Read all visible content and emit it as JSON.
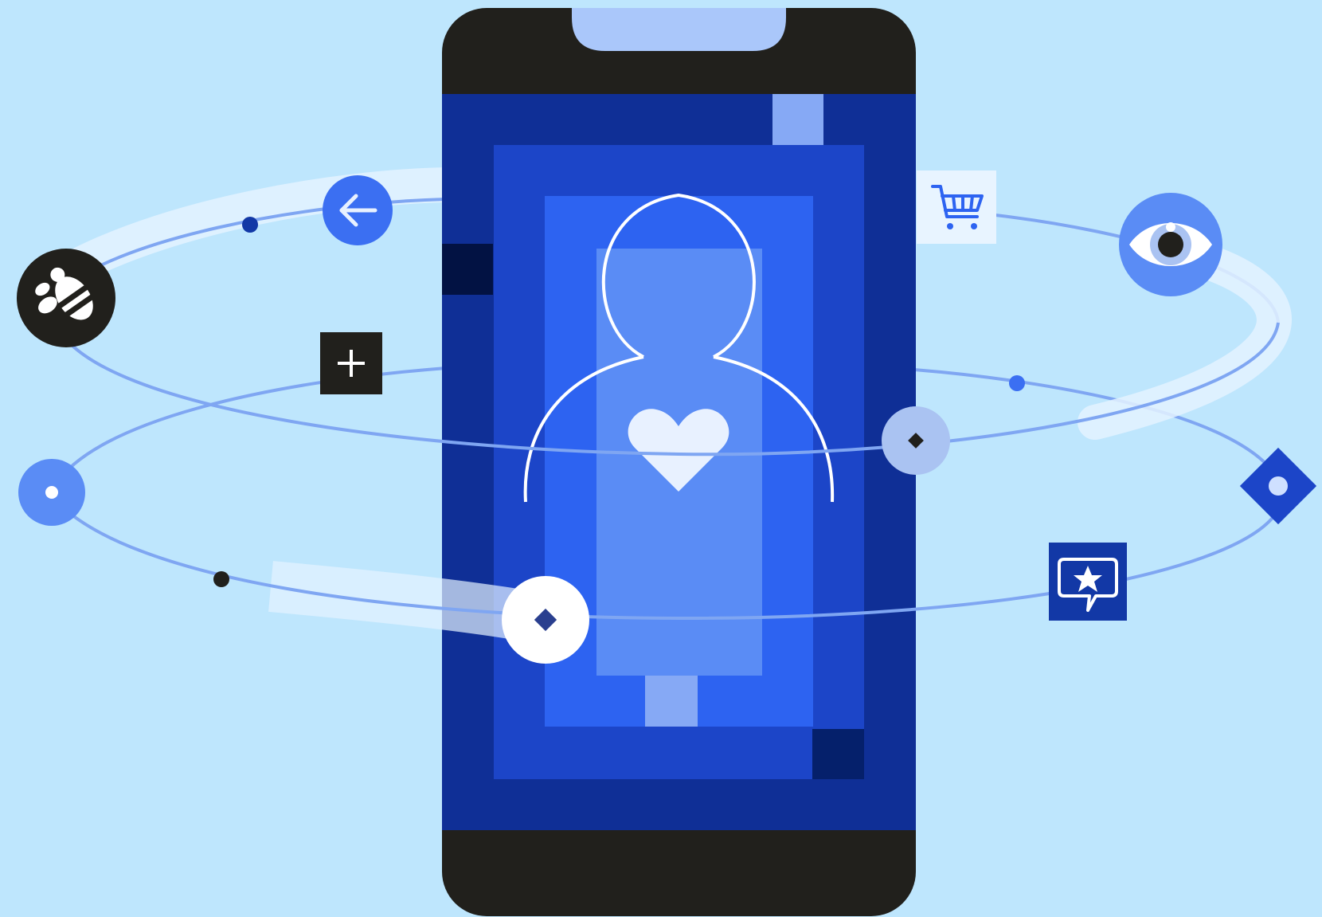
{
  "colors": {
    "background": "#bee6fd",
    "phone_frame": "#21201c",
    "phone_notch": "#aac7fa",
    "screen_outer": "#0f2f96",
    "screen_mid": "#1c45c8",
    "screen_inner": "#2d63f1",
    "person_fill": "#5a8cf5",
    "accent_light": "#86a9f5",
    "orbit_line": "#7fa6f2",
    "orbit_trail": "#e4f2ff",
    "icon_blue": "#3b6ff2",
    "icon_dark": "#21201c",
    "icon_navy": "#1238a6",
    "white": "#ffffff"
  },
  "icons": [
    "bee-icon",
    "back-arrow-icon",
    "plus-icon",
    "shopping-cart-icon",
    "eye-icon",
    "heart-icon",
    "person-icon",
    "star-chat-icon",
    "diamond-icon",
    "node-dot-icon"
  ]
}
